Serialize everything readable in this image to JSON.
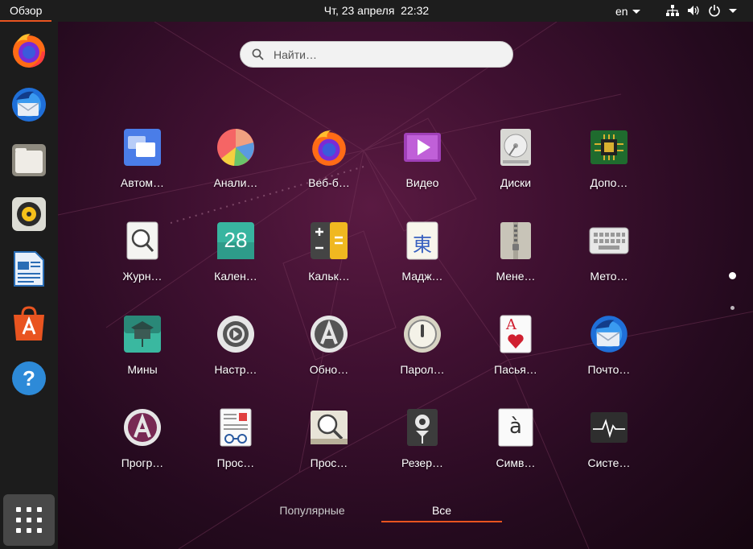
{
  "topbar": {
    "overview_label": "Обзор",
    "clock": "Чт, 23 апреля  22:32",
    "language": "en"
  },
  "dock": {
    "items": [
      {
        "name": "firefox",
        "icon": "firefox-icon"
      },
      {
        "name": "thunderbird",
        "icon": "thunderbird-icon"
      },
      {
        "name": "files",
        "icon": "files-icon"
      },
      {
        "name": "rhythmbox",
        "icon": "rhythmbox-icon"
      },
      {
        "name": "libreoffice-writer",
        "icon": "writer-icon"
      },
      {
        "name": "ubuntu-software",
        "icon": "software-icon"
      },
      {
        "name": "help",
        "icon": "help-icon"
      }
    ],
    "show_apps_icon": "grid-icon"
  },
  "search": {
    "placeholder": "Найти…"
  },
  "apps": [
    {
      "label": "Автом…"
    },
    {
      "label": "Анали…"
    },
    {
      "label": "Веб-б…"
    },
    {
      "label": "Видео"
    },
    {
      "label": "Диски"
    },
    {
      "label": "Допо…"
    },
    {
      "label": "Журн…"
    },
    {
      "label": "Кален…"
    },
    {
      "label": "Кальк…"
    },
    {
      "label": "Мадж…"
    },
    {
      "label": "Мене…"
    },
    {
      "label": "Мето…"
    },
    {
      "label": "Мины"
    },
    {
      "label": "Настр…"
    },
    {
      "label": "Обно…"
    },
    {
      "label": "Парол…"
    },
    {
      "label": "Пасья…"
    },
    {
      "label": "Почто…"
    },
    {
      "label": "Прогр…"
    },
    {
      "label": "Прос…"
    },
    {
      "label": "Прос…"
    },
    {
      "label": "Резер…"
    },
    {
      "label": "Симв…"
    },
    {
      "label": "Систе…"
    }
  ],
  "calendar_day": "28",
  "mahjongg_glyph": "東",
  "cards_glyph": "A",
  "charmap_glyph": "à",
  "tabs": {
    "popular": "Популярные",
    "all": "Все",
    "active": "all"
  },
  "pager": {
    "pages": 2,
    "current": 1
  },
  "colors": {
    "accent": "#e95420",
    "topbar": "#1d1d1d",
    "dock": "#1c1c1c"
  }
}
